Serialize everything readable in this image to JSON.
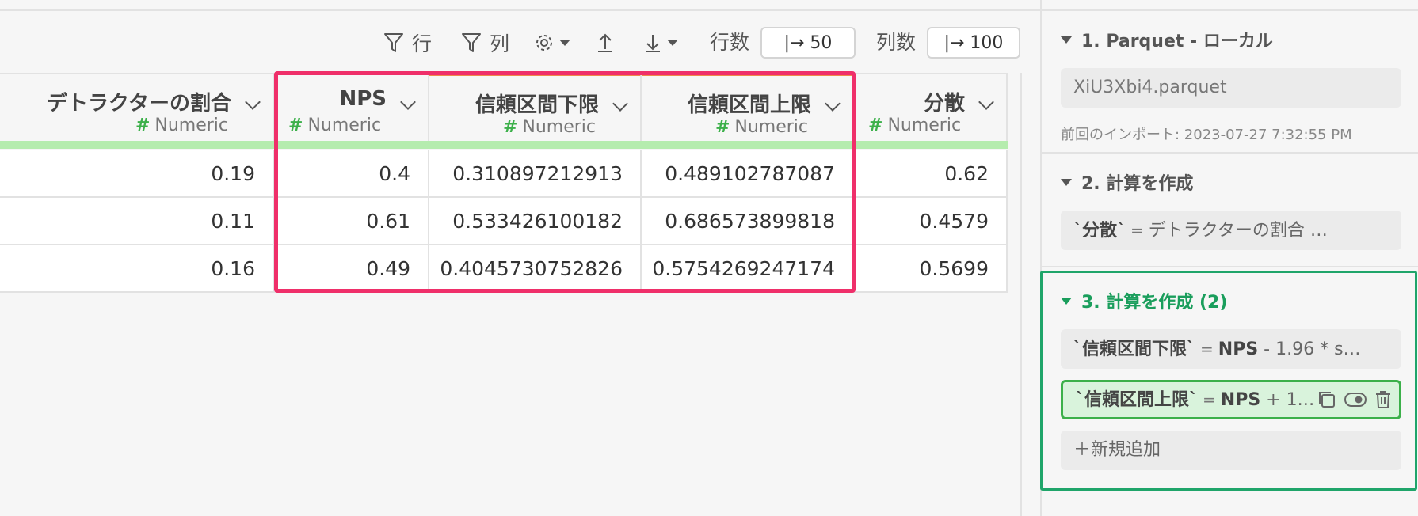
{
  "toolbar": {
    "row_filter_label": "行",
    "col_filter_label": "列",
    "row_count_label": "行数",
    "row_count_value": "|→ 50",
    "col_count_label": "列数",
    "col_count_value": "|→ 100"
  },
  "table": {
    "columns": [
      {
        "name": "デトラクターの割合",
        "type": "Numeric"
      },
      {
        "name": "NPS",
        "type": "Numeric"
      },
      {
        "name": "信頼区間下限",
        "type": "Numeric"
      },
      {
        "name": "信頼区間上限",
        "type": "Numeric"
      },
      {
        "name": "分散",
        "type": "Numeric"
      }
    ],
    "rows": [
      [
        "0.19",
        "0.4",
        "0.310897212913",
        "0.489102787087",
        "0.62"
      ],
      [
        "0.11",
        "0.61",
        "0.533426100182",
        "0.686573899818",
        "0.4579"
      ],
      [
        "0.16",
        "0.49",
        "0.4045730752826",
        "0.5754269247174",
        "0.5699"
      ]
    ]
  },
  "sidebar": {
    "step1": {
      "title": "1. Parquet - ローカル",
      "file": "XiU3Xbi4.parquet",
      "meta": "前回のインポート: 2023-07-27 7:32:55 PM"
    },
    "step2": {
      "title": "2. 計算を作成",
      "calc_name": "`分散`",
      "calc_eq": "=",
      "calc_expr": "デトラクターの割合 …"
    },
    "step3": {
      "title": "3. 計算を作成 (2)",
      "calc1_name": "`信頼区間下限`",
      "calc1_eq": "=",
      "calc1_nps": "NPS",
      "calc1_rest": "- 1.96 * s…",
      "calc2_name": "`信頼区間上限`",
      "calc2_eq": "=",
      "calc2_nps": "NPS",
      "calc2_rest": "+ 1.…",
      "add_label": "＋新規追加"
    }
  },
  "colors": {
    "highlight": "#ef2f6a",
    "accent_green": "#1fa56a",
    "type_bar": "#b5ecae",
    "header_accent": "#f08a4b"
  }
}
